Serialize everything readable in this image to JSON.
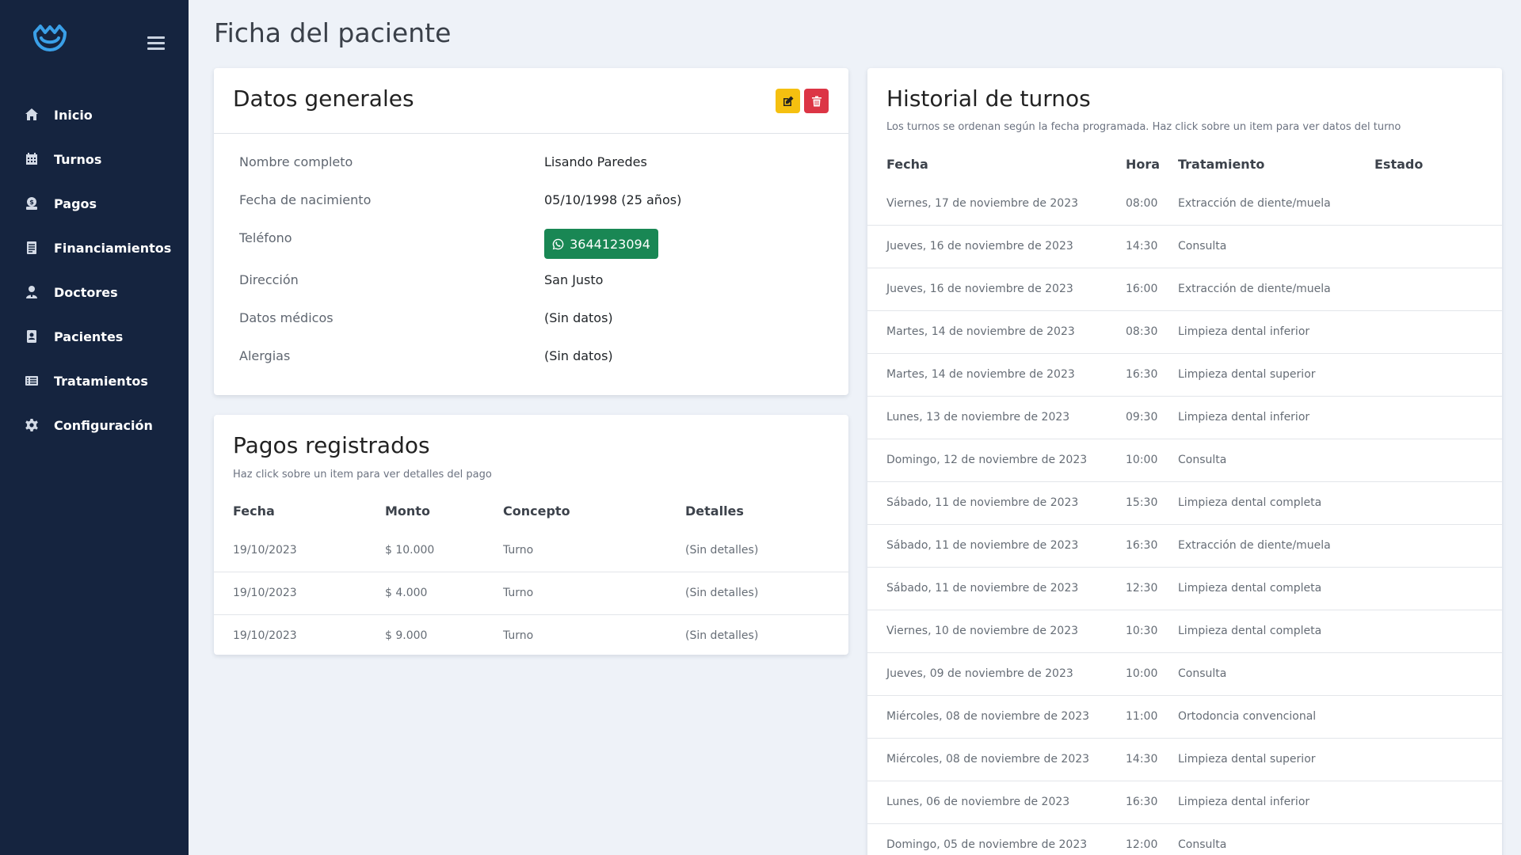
{
  "sidebar": {
    "items": [
      {
        "label": "Inicio",
        "icon": "home-icon"
      },
      {
        "label": "Turnos",
        "icon": "calendar-icon"
      },
      {
        "label": "Pagos",
        "icon": "money-icon"
      },
      {
        "label": "Financiamientos",
        "icon": "document-icon"
      },
      {
        "label": "Doctores",
        "icon": "doctor-icon"
      },
      {
        "label": "Pacientes",
        "icon": "patient-icon"
      },
      {
        "label": "Tratamientos",
        "icon": "list-icon"
      },
      {
        "label": "Configuración",
        "icon": "gear-icon"
      }
    ]
  },
  "page": {
    "title": "Ficha del paciente"
  },
  "datos": {
    "title": "Datos generales",
    "fields": {
      "nombre": {
        "label": "Nombre completo",
        "value": "Lisando Paredes"
      },
      "nacimiento": {
        "label": "Fecha de nacimiento",
        "value": "05/10/1998 (25 años)"
      },
      "telefono": {
        "label": "Teléfono",
        "value": "3644123094"
      },
      "direccion": {
        "label": "Dirección",
        "value": "San Justo"
      },
      "medicos": {
        "label": "Datos médicos",
        "value": "(Sin datos)"
      },
      "alergias": {
        "label": "Alergias",
        "value": "(Sin datos)"
      }
    }
  },
  "pagos": {
    "title": "Pagos registrados",
    "subtitle": "Haz click sobre un item para ver detalles del pago",
    "columns": [
      "Fecha",
      "Monto",
      "Concepto",
      "Detalles"
    ],
    "rows": [
      [
        "19/10/2023",
        "$ 10.000",
        "Turno",
        "(Sin detalles)"
      ],
      [
        "19/10/2023",
        "$ 4.000",
        "Turno",
        "(Sin detalles)"
      ],
      [
        "19/10/2023",
        "$ 9.000",
        "Turno",
        "(Sin detalles)"
      ]
    ]
  },
  "historial": {
    "title": "Historial de turnos",
    "subtitle": "Los turnos se ordenan según la fecha programada. Haz click sobre un item para ver datos del turno",
    "columns": [
      "Fecha",
      "Hora",
      "Tratamiento",
      "Estado"
    ],
    "rows": [
      [
        "Viernes, 17 de noviembre de 2023",
        "08:00",
        "Extracción de diente/muela",
        ""
      ],
      [
        "Jueves, 16 de noviembre de 2023",
        "14:30",
        "Consulta",
        ""
      ],
      [
        "Jueves, 16 de noviembre de 2023",
        "16:00",
        "Extracción de diente/muela",
        ""
      ],
      [
        "Martes, 14 de noviembre de 2023",
        "08:30",
        "Limpieza dental inferior",
        ""
      ],
      [
        "Martes, 14 de noviembre de 2023",
        "16:30",
        "Limpieza dental superior",
        ""
      ],
      [
        "Lunes, 13 de noviembre de 2023",
        "09:30",
        "Limpieza dental inferior",
        ""
      ],
      [
        "Domingo, 12 de noviembre de 2023",
        "10:00",
        "Consulta",
        ""
      ],
      [
        "Sábado, 11 de noviembre de 2023",
        "15:30",
        "Limpieza dental completa",
        ""
      ],
      [
        "Sábado, 11 de noviembre de 2023",
        "16:30",
        "Extracción de diente/muela",
        ""
      ],
      [
        "Sábado, 11 de noviembre de 2023",
        "12:30",
        "Limpieza dental completa",
        ""
      ],
      [
        "Viernes, 10 de noviembre de 2023",
        "10:30",
        "Limpieza dental completa",
        ""
      ],
      [
        "Jueves, 09 de noviembre de 2023",
        "10:00",
        "Consulta",
        ""
      ],
      [
        "Miércoles, 08 de noviembre de 2023",
        "11:00",
        "Ortodoncia convencional",
        ""
      ],
      [
        "Miércoles, 08 de noviembre de 2023",
        "14:30",
        "Limpieza dental superior",
        ""
      ],
      [
        "Lunes, 06 de noviembre de 2023",
        "16:30",
        "Limpieza dental inferior",
        ""
      ],
      [
        "Domingo, 05 de noviembre de 2023",
        "12:00",
        "Consulta",
        ""
      ]
    ]
  },
  "colors": {
    "sidebar_bg": "#15243f",
    "page_bg": "#eef2f8",
    "edit_button": "#f5c010",
    "delete_button": "#dc3545",
    "phone_button": "#198754",
    "logo": "#3aa0e8"
  }
}
